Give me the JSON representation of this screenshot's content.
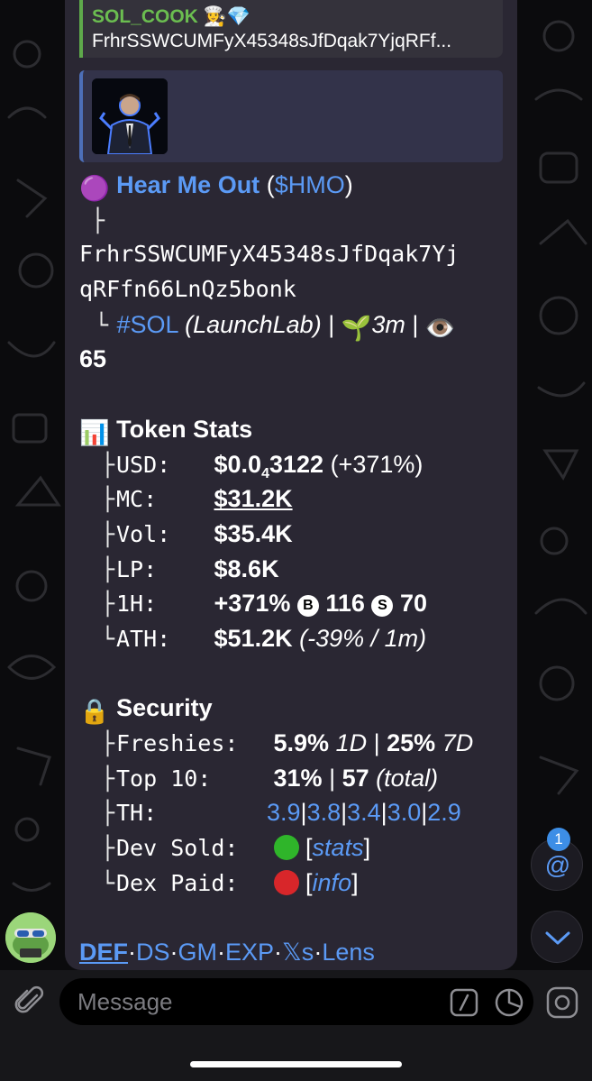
{
  "reply": {
    "sender": "SOL_COOK 👩‍🍳💎",
    "text": "FrhrSSWCUMFyX45348sJfDqak7YjqRFf..."
  },
  "token": {
    "emoji": "🟣",
    "name": "Hear Me Out",
    "ticker_open": " (",
    "ticker": "$HMO",
    "ticker_close": ")",
    "address_line1": "FrhrSSWCUMFyX45348sJfDqak7Yj",
    "address_line2": "qRFfn66LnQz5bonk",
    "chain_tag": "#SOL",
    "platform": "(LaunchLab)",
    "sep1": " | ",
    "age_emoji": "🌱",
    "age": "3m",
    "sep2": " | ",
    "views_emoji": "👁️",
    "views": "65"
  },
  "token_stats": {
    "emoji": "📊",
    "title": "Token Stats",
    "usd_label": "USD:",
    "usd_prefix": "$0.0",
    "usd_sub": "4",
    "usd_rest": "3122",
    "usd_change": " (+371%)",
    "mc_label": "MC:",
    "mc_value": "$31.2K",
    "vol_label": "Vol:",
    "vol_value": "$35.4K",
    "lp_label": "LP:",
    "lp_value": "$8.6K",
    "h1_label": "1H:",
    "h1_change": "+371%",
    "h1_buy_icon": "B",
    "h1_buys": "116",
    "h1_sell_icon": "S",
    "h1_sells": "70",
    "ath_label": "ATH:",
    "ath_value": "$51.2K",
    "ath_note": "(-39% / 1m)"
  },
  "security": {
    "emoji": "🔒",
    "title": "Security",
    "freshies_label": "Freshies:",
    "freshies_1d_value": "5.9%",
    "freshies_1d_label": "1D",
    "freshies_sep": " | ",
    "freshies_7d_value": "25%",
    "freshies_7d_label": "7D",
    "top10_label": "Top 10:",
    "top10_value": "31%",
    "top10_sep": " | ",
    "top10_count": "57",
    "top10_note": "(total)",
    "th_label": "TH:",
    "th_values": [
      "3.9",
      "3.8",
      "3.4",
      "3.0",
      "2.9"
    ],
    "th_sep": "|",
    "dev_sold_label": "Dev Sold:",
    "dev_sold_link": "stats",
    "dex_paid_label": "Dex Paid:",
    "dex_paid_link": "info",
    "bracket_open": "[",
    "bracket_close": "]",
    "status_colors": {
      "dev_sold": "#2fb52a",
      "dex_paid": "#d8262a"
    }
  },
  "tree": {
    "branch": "├",
    "end": "└"
  },
  "links": {
    "items": [
      "DEF",
      "DS",
      "GM",
      "EXP",
      "𝕏s",
      "Lens"
    ],
    "separator": "·"
  },
  "fabs": {
    "mention_badge": "1",
    "mention_icon": "@"
  },
  "composer": {
    "placeholder": "Message",
    "attach_icon": "paperclip-icon",
    "commands_icon": "slash-command-icon",
    "sticker_icon": "sticker-icon",
    "camera_icon": "camera-icon"
  },
  "colors": {
    "link": "#5b9af5",
    "bubble": "#2a2733",
    "accent_green": "#6bbd50"
  }
}
